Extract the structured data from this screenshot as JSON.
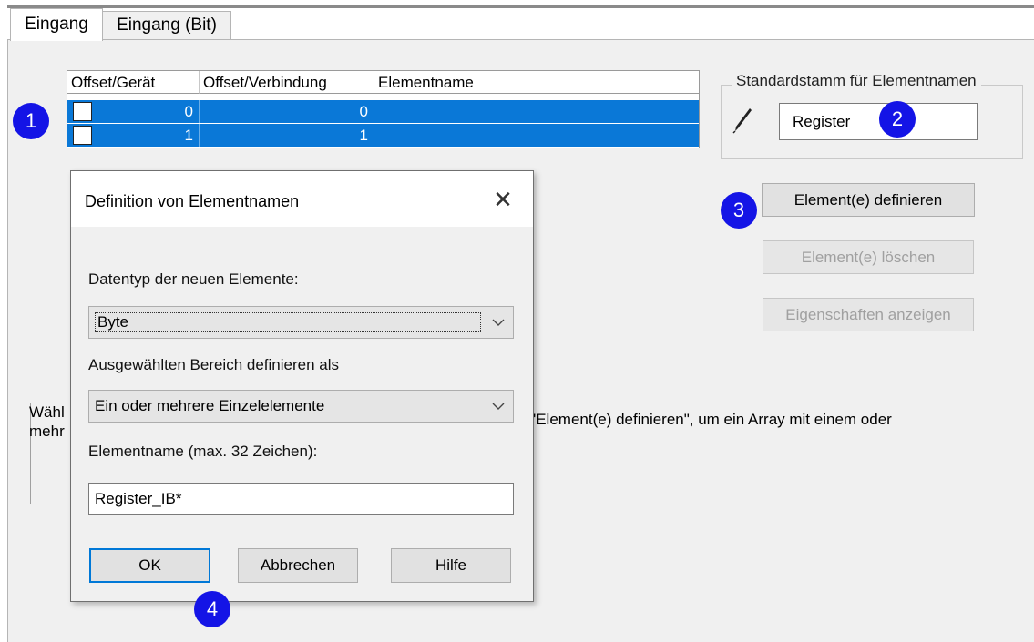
{
  "tabs": [
    {
      "label": "Eingang",
      "active": true
    },
    {
      "label": "Eingang (Bit)",
      "active": false
    }
  ],
  "table": {
    "columns": [
      "Offset/Gerät",
      "Offset/Verbindung",
      "Elementname"
    ],
    "rows": [
      {
        "offset_device": "0",
        "offset_connection": "0",
        "element_name": "",
        "selected": true
      },
      {
        "offset_device": "1",
        "offset_connection": "1",
        "element_name": "",
        "selected": true
      }
    ]
  },
  "stem_group": {
    "title": "Standardstamm für Elementnamen",
    "value": "Register",
    "icon": "pencil-icon"
  },
  "buttons": {
    "define": "Element(e) definieren",
    "delete": "Element(e) löschen",
    "properties": "Eigenschaften anzeigen"
  },
  "description": {
    "left_line1": "Wähl",
    "left_line2": "mehr",
    "right": "e \"Element(e) definieren\", um ein Array mit einem oder"
  },
  "dialog": {
    "title": "Definition von Elementnamen",
    "datatype_label": "Datentyp der neuen Elemente:",
    "datatype_value": "Byte",
    "range_label": "Ausgewählten Bereich definieren als",
    "range_value": "Ein oder mehrere Einzelelemente",
    "name_label": "Elementname (max. 32 Zeichen):",
    "name_value": "Register_IB*",
    "ok": "OK",
    "cancel": "Abbrechen",
    "help": "Hilfe"
  },
  "badges": [
    "1",
    "2",
    "3",
    "4"
  ],
  "colors": {
    "selection": "#0a78d7",
    "badge": "#1414e6",
    "window_bg": "#f0f0f0"
  }
}
